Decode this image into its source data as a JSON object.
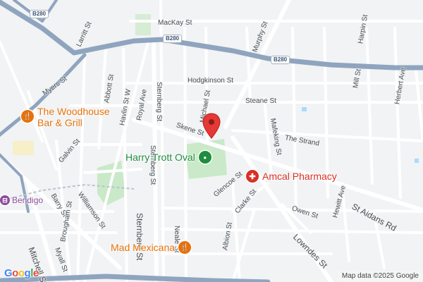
{
  "map": {
    "colors": {
      "background": "#f1f3f4",
      "road": "#ffffff",
      "major_road": "#8fa4be",
      "park": "#c9e9c8",
      "water": "#aadaff",
      "poi_food": "#e8710a",
      "poi_park": "#1e8e3e",
      "poi_health": "#d93025",
      "transit": "#8c4c9e",
      "pin": "#e53935"
    },
    "streets": [
      "MacKay St",
      "Murphy St",
      "Larritt St",
      "Myers St",
      "Abbott St",
      "Hodgkinson St",
      "Havlin St W",
      "Royal Ave",
      "Sternberg St",
      "Michael St",
      "Steane St",
      "Mafeking St",
      "Skene St",
      "The Strand",
      "Galvin St",
      "Williamson St",
      "Barry St",
      "Glencoe St",
      "Clarke St",
      "Owen St",
      "Hewitt Ave",
      "St Aidans Rd",
      "Lowndes St",
      "Neale St",
      "Brougham St",
      "Myall St",
      "Mitchell St",
      "Albion St",
      "Mill St",
      "Harpin St",
      "Herbert Ave"
    ],
    "shields": [
      "B280",
      "B280",
      "B280"
    ],
    "pois": [
      {
        "name": "The Woodhouse Bar & Grill",
        "line1": "The Woodhouse",
        "line2": "Bar & Grill",
        "icon": "restaurant-icon",
        "glyph": "🍴"
      },
      {
        "name": "Harry Trott Oval",
        "icon": "park-icon",
        "glyph": "●"
      },
      {
        "name": "Amcal Pharmacy",
        "icon": "pharmacy-icon",
        "glyph": "✚"
      },
      {
        "name": "Mad Mexicana",
        "icon": "restaurant-icon",
        "glyph": "🍴"
      },
      {
        "name": "Bendigo",
        "icon": "train-station-icon",
        "glyph": "⊟"
      }
    ],
    "marker": {
      "label": "location-pin"
    },
    "branding": {
      "logo": "Google"
    },
    "attribution": "Map data ©2025 Google"
  }
}
